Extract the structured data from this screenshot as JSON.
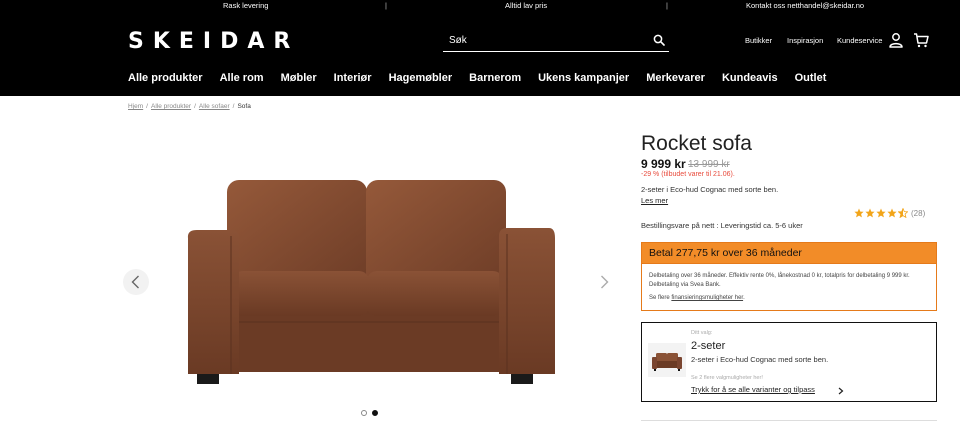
{
  "topbar": {
    "items": [
      "Rask levering",
      "Alltid lav pris",
      "Kontakt oss netthandel@skeidar.no"
    ],
    "separator": "|"
  },
  "header": {
    "logo": "SKEIDAR",
    "search_placeholder": "Søk",
    "util_links": [
      "Butikker",
      "Inspirasjon",
      "Kundeservice"
    ],
    "icons": [
      "search-icon",
      "user-icon",
      "cart-icon"
    ]
  },
  "nav": {
    "items": [
      "Alle produkter",
      "Alle rom",
      "Møbler",
      "Interiør",
      "Hagemøbler",
      "Barnerom",
      "Ukens kampanjer",
      "Merkevarer",
      "Kundeavis",
      "Outlet"
    ]
  },
  "breadcrumb": {
    "items": [
      "Hjem",
      "Alle produkter",
      "Alle sofaer"
    ],
    "current": "Sofa",
    "separator": "/"
  },
  "gallery": {
    "image_count": 2,
    "active_index": 2,
    "icons": [
      "chevron-left-icon",
      "chevron-right-icon"
    ]
  },
  "product": {
    "title": "Rocket sofa",
    "price": "9 999 kr",
    "old_price": "13 999 kr",
    "discount": "-29 % (tilbudet varer til 21.06).",
    "description": "2-seter i Eco-hud Cognac med sorte ben.",
    "read_more": "Les mer",
    "rating": 4.5,
    "review_count": "(28)",
    "delivery": "Bestillingsvare på nett : Leveringstid ca. 5-6 uker"
  },
  "finance": {
    "headline": "Betal 277,75 kr over 36 måneder",
    "details": "Delbetaling over 36 måneder. Effektiv rente 0%, lånekostnad 0 kr, totalpris for delbetaling 9 999 kr. Delbetaling via Svea Bank.",
    "see_prefix": "Se flere ",
    "see_link": "finansieringsmuligheter her",
    "see_suffix": ".",
    "accent_color": "#f28c28"
  },
  "variant": {
    "label": "Ditt valg:",
    "name": "2-seter",
    "description": "2-seter i Eco-hud Cognac med sorte ben.",
    "note": "Se 2 flere valgmuligheter her!",
    "link": "Trykk for å se alle varianter og tilpass"
  }
}
